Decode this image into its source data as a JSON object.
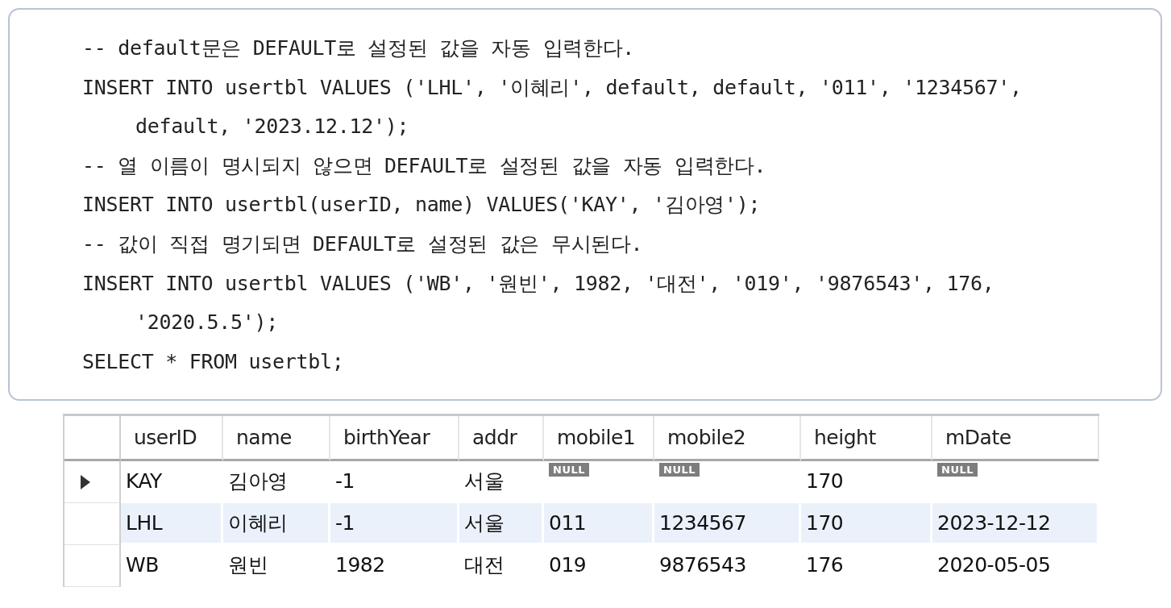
{
  "code_lines": [
    {
      "text": "-- default문은 DEFAULT로 설정된 값을 자동 입력한다.",
      "continued": false
    },
    {
      "text": "INSERT INTO usertbl VALUES ('LHL', '이혜리', default, default, '011', '1234567',",
      "continued": false
    },
    {
      "text": "default, '2023.12.12');",
      "continued": true
    },
    {
      "text": "-- 열 이름이 명시되지 않으면 DEFAULT로 설정된 값을 자동 입력한다.",
      "continued": false
    },
    {
      "text": "INSERT INTO usertbl(userID, name) VALUES('KAY', '김아영');",
      "continued": false
    },
    {
      "text": "-- 값이 직접 명기되면 DEFAULT로 설정된 값은 무시된다.",
      "continued": false
    },
    {
      "text": "INSERT INTO usertbl VALUES ('WB', '원빈', 1982, '대전', '019', '9876543', 176,",
      "continued": false
    },
    {
      "text": "'2020.5.5');",
      "continued": true
    },
    {
      "text": "SELECT * FROM usertbl;",
      "continued": false
    }
  ],
  "result_grid": {
    "columns": [
      "userID",
      "name",
      "birthYear",
      "addr",
      "mobile1",
      "mobile2",
      "height",
      "mDate"
    ],
    "rows": [
      {
        "current": true,
        "cells": [
          {
            "kind": "text",
            "text": "KAY"
          },
          {
            "kind": "text",
            "text": "김아영"
          },
          {
            "kind": "text",
            "text": "-1"
          },
          {
            "kind": "text",
            "text": "서울"
          },
          {
            "kind": "null",
            "text": "NULL"
          },
          {
            "kind": "null",
            "text": "NULL"
          },
          {
            "kind": "text",
            "text": "170"
          },
          {
            "kind": "null",
            "text": "NULL"
          }
        ]
      },
      {
        "current": false,
        "cells": [
          {
            "kind": "text",
            "text": "LHL"
          },
          {
            "kind": "text",
            "text": "이혜리"
          },
          {
            "kind": "text",
            "text": "-1"
          },
          {
            "kind": "text",
            "text": "서울"
          },
          {
            "kind": "text",
            "text": "011"
          },
          {
            "kind": "text",
            "text": "1234567"
          },
          {
            "kind": "text",
            "text": "170"
          },
          {
            "kind": "text",
            "text": "2023-12-12"
          }
        ]
      },
      {
        "current": false,
        "cells": [
          {
            "kind": "text",
            "text": "WB"
          },
          {
            "kind": "text",
            "text": "원빈"
          },
          {
            "kind": "text",
            "text": "1982"
          },
          {
            "kind": "text",
            "text": "대전"
          },
          {
            "kind": "text",
            "text": "019"
          },
          {
            "kind": "text",
            "text": "9876543"
          },
          {
            "kind": "text",
            "text": "176"
          },
          {
            "kind": "text",
            "text": "2020-05-05"
          }
        ]
      }
    ]
  }
}
